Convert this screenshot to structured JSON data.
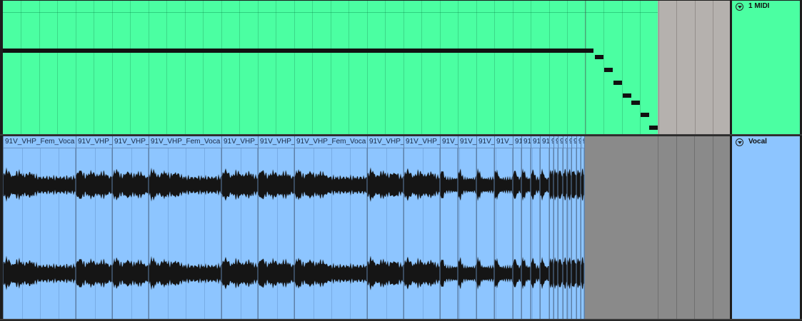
{
  "tracks": {
    "midi": {
      "name": "1 MIDI",
      "color": "#4bffa2",
      "fold_icon": "chevron-down-icon"
    },
    "vocal": {
      "name": "Vocal",
      "color": "#8dc5ff",
      "fold_icon": "chevron-down-icon"
    }
  },
  "vocal_clips": [
    {
      "title": "91V_VHP_Fem_Voca"
    },
    {
      "title": "91V_VHP_"
    },
    {
      "title": "91V_VHP_"
    },
    {
      "title": "91V_VHP_Fem_Voca"
    },
    {
      "title": "91V_VHP_"
    },
    {
      "title": "91V_VHP_"
    },
    {
      "title": "91V_VHP_Fem_Voca"
    },
    {
      "title": "91V_VHP_"
    },
    {
      "title": "91V_VHP_"
    },
    {
      "title": "91V_"
    },
    {
      "title": "91V_"
    },
    {
      "title": "91V_"
    },
    {
      "title": "91V_"
    },
    {
      "title": "91"
    },
    {
      "title": "91"
    },
    {
      "title": "91"
    },
    {
      "title": "91"
    },
    {
      "title": "9"
    },
    {
      "title": "9"
    },
    {
      "title": "9"
    },
    {
      "title": "9"
    },
    {
      "title": "9"
    },
    {
      "title": "9"
    },
    {
      "title": "9"
    },
    {
      "title": "9"
    },
    {
      "title": "9"
    }
  ]
}
